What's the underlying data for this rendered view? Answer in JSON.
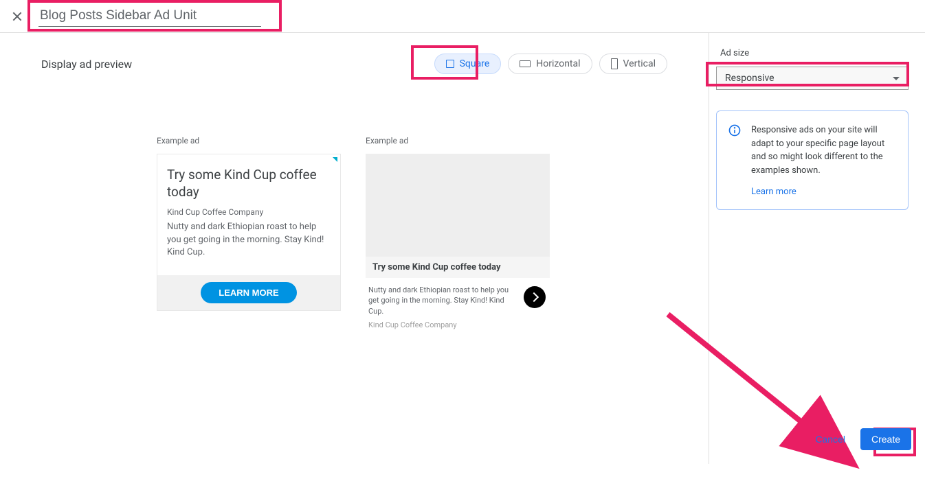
{
  "header": {
    "title_value": "Blog Posts Sidebar Ad Unit"
  },
  "preview": {
    "label": "Display ad preview",
    "chips": {
      "square": "Square",
      "horizontal": "Horizontal",
      "vertical": "Vertical"
    }
  },
  "examples": {
    "label": "Example ad",
    "ad1": {
      "title": "Try some Kind Cup coffee today",
      "company": "Kind Cup Coffee Company",
      "desc": "Nutty and dark Ethiopian roast to help you get going in the morning. Stay Kind! Kind Cup.",
      "cta": "LEARN MORE"
    },
    "ad2": {
      "title": "Try some Kind Cup coffee today",
      "desc": "Nutty and dark Ethiopian roast to help you get going in the morning. Stay Kind! Kind Cup.",
      "company": "Kind Cup Coffee Company"
    }
  },
  "sidebar": {
    "size_label": "Ad size",
    "size_value": "Responsive",
    "info_text": "Responsive ads on your site will adapt to your specific page layout and so might look different to the examples shown.",
    "learn_more": "Learn more",
    "cancel": "Cancel",
    "create": "Create"
  }
}
